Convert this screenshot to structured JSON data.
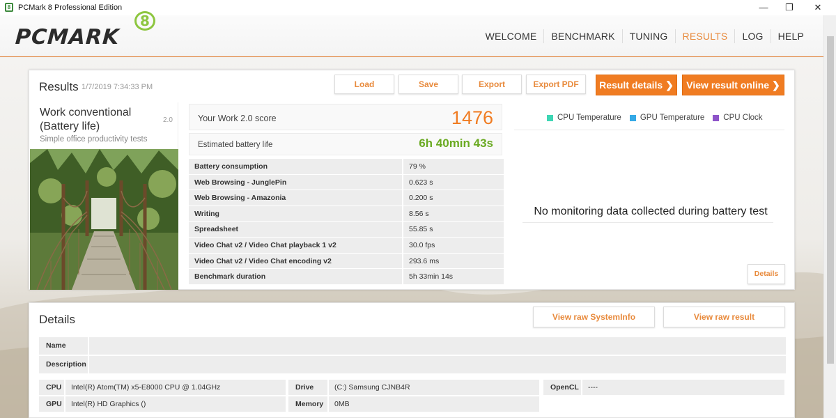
{
  "window": {
    "title": "PCMark 8 Professional Edition",
    "app_icon": "pcmark-icon",
    "controls": [
      "—",
      "❐",
      "✕"
    ]
  },
  "header": {
    "logo_text": "PCMARK",
    "logo_badge": "8",
    "nav": [
      {
        "label": "WELCOME",
        "active": false
      },
      {
        "label": "BENCHMARK",
        "active": false
      },
      {
        "label": "TUNING",
        "active": false
      },
      {
        "label": "RESULTS",
        "active": true
      },
      {
        "label": "LOG",
        "active": false
      },
      {
        "label": "HELP",
        "active": false
      }
    ],
    "accent_color": "#e88a3c"
  },
  "results": {
    "title": "Results",
    "date": "1/7/2019 7:34:33 PM",
    "buttons": {
      "load": "Load",
      "save": "Save",
      "export": "Export",
      "export_pdf": "Export PDF",
      "result_details": "Result details ❯",
      "view_online": "View result online ❯"
    },
    "test": {
      "name": "Work conventional (Battery life)",
      "version": "2.0",
      "description": "Simple office productivity tests"
    },
    "score": {
      "label": "Your Work 2.0 score",
      "value": "1476"
    },
    "battery": {
      "label": "Estimated battery life",
      "value": "6h 40min 43s"
    },
    "metrics": [
      {
        "name": "Battery consumption",
        "value": "79 %"
      },
      {
        "name": "Web Browsing - JunglePin",
        "value": "0.623 s"
      },
      {
        "name": "Web Browsing - Amazonia",
        "value": "0.200 s"
      },
      {
        "name": "Writing",
        "value": "8.56 s"
      },
      {
        "name": "Spreadsheet",
        "value": "55.85 s"
      },
      {
        "name": "Video Chat v2 / Video Chat playback 1 v2",
        "value": "30.0 fps"
      },
      {
        "name": "Video Chat v2 / Video Chat encoding v2",
        "value": "293.6 ms"
      },
      {
        "name": "Benchmark duration",
        "value": "5h 33min 14s"
      }
    ],
    "monitoring": {
      "legend": [
        {
          "label": "CPU Temperature",
          "color": "#3ed6b4"
        },
        {
          "label": "GPU Temperature",
          "color": "#35a9e6"
        },
        {
          "label": "CPU Clock",
          "color": "#8e54c9"
        }
      ],
      "message": "No monitoring data collected during battery test",
      "details_button": "Details"
    }
  },
  "details": {
    "title": "Details",
    "buttons": {
      "systeminfo": "View raw SystemInfo",
      "result": "View raw result"
    },
    "name_label": "Name",
    "description_label": "Description",
    "specs": {
      "cpu_label": "CPU",
      "cpu_value": "Intel(R) Atom(TM) x5-E8000  CPU @ 1.04GHz",
      "gpu_label": "GPU",
      "gpu_value": "Intel(R) HD Graphics ()",
      "drive_label": "Drive",
      "drive_value": "(C:) Samsung CJNB4R",
      "memory_label": "Memory",
      "memory_value": "0MB",
      "opencl_label": "OpenCL",
      "opencl_value": "----"
    }
  }
}
